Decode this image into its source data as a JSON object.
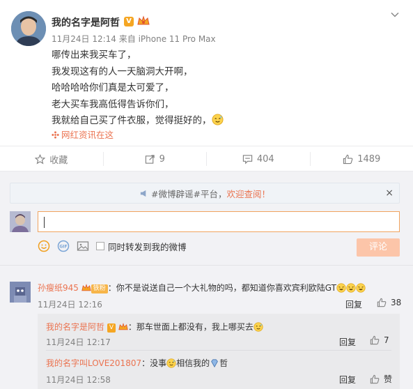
{
  "post": {
    "author": "我的名字是阿哲",
    "verified_badge": "V",
    "meta": "11月24日 12:14 来自 iPhone 11 Pro Max",
    "lines": [
      "哪传出来我买车了，",
      "我发现这有的人一天脑洞大开啊，",
      "哈哈哈哈你们真是太可爱了，",
      "老大买车我高低得告诉你们，",
      "我就给自己买了件衣服，觉得挺好的，"
    ],
    "tag": "网红资讯在这"
  },
  "actions": {
    "favorite": "收藏",
    "repost": "9",
    "comment": "404",
    "like": "1489"
  },
  "notice": {
    "text": "#微博辟谣#平台，",
    "highlight": "欢迎查阅！",
    "close": "×"
  },
  "compose": {
    "sync_label": "同时转发到我的微博",
    "submit": "评论"
  },
  "comments": [
    {
      "name": "孙瘦纸945",
      "fan_badge": "铁粉",
      "text": "：你不是说送自己一个大礼物的吗，都知道你喜欢宾利欧陆GT",
      "time": "11月24日 12:16",
      "reply": "回复",
      "likes": "38"
    }
  ],
  "replies": [
    {
      "name": "我的名字是阿哲",
      "verified_badge": "V",
      "text": "：那车世面上都没有，我上哪买去",
      "time": "11月24日 12:17",
      "reply": "回复",
      "likes": "7"
    },
    {
      "name": "我的名字叫LOVE201807",
      "text_a": "：没事",
      "text_b": "相信我的",
      "text_c": "哲",
      "time": "11月24日 12:58",
      "reply": "回复",
      "likes": "赞"
    }
  ],
  "colors": {
    "accent": "#eb7350",
    "meta_gray": "#808080",
    "comment_bg": "#f2f2f5",
    "submit_disabled": "#fcc5a9"
  },
  "icons": {
    "post_avatar": "avatar-photo",
    "crown": "crown-icon",
    "menu": "chevron-down-icon",
    "favorite": "star-icon",
    "repost": "repost-icon",
    "comment": "comment-icon",
    "like": "thumb-up-icon",
    "emoji": "smiley-icon",
    "gif": "gif-icon",
    "image": "image-icon"
  }
}
